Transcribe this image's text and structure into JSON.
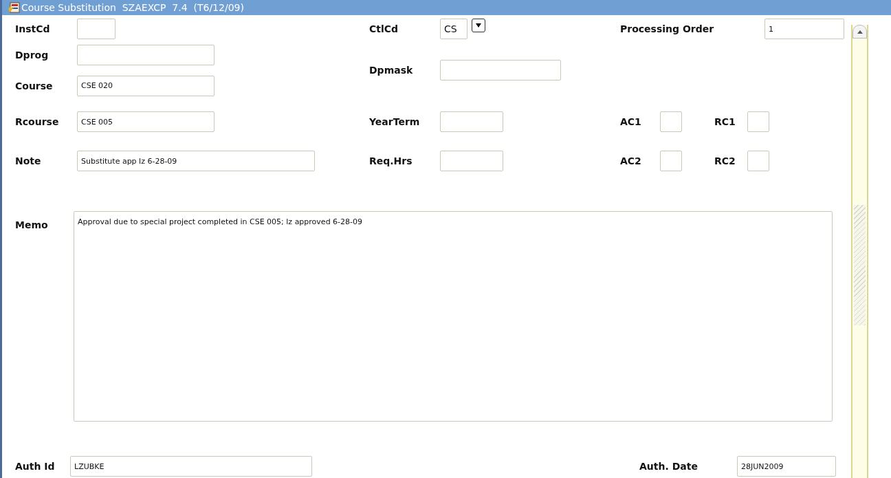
{
  "window": {
    "title": "Course Substitution  SZAEXCP  7.4  (T6/12/09)"
  },
  "fields": {
    "inst_cd": {
      "label": "InstCd"
    },
    "dprog": {
      "label": "Dprog"
    },
    "course": {
      "label": "Course",
      "value": "CSE 020"
    },
    "rcourse": {
      "label": "Rcourse",
      "value": "CSE 005"
    },
    "note": {
      "label": "Note",
      "value": "Substitute app lz 6-28-09"
    },
    "ctl_cd": {
      "label": "CtlCd",
      "value": "CS"
    },
    "dpmask": {
      "label": "Dpmask"
    },
    "year_term": {
      "label": "YearTerm"
    },
    "req_hrs": {
      "label": "Req.Hrs"
    },
    "processing_order": {
      "label": "Processing Order",
      "value": "1"
    },
    "ac1": {
      "label": "AC1"
    },
    "rc1": {
      "label": "RC1"
    },
    "ac2": {
      "label": "AC2"
    },
    "rc2": {
      "label": "RC2"
    },
    "memo": {
      "label": "Memo",
      "value": "Approval due to special project completed in CSE 005; lz approved 6-28-09"
    },
    "auth_id": {
      "label": "Auth Id",
      "value": "LZUBKE"
    },
    "auth_date": {
      "label": "Auth. Date",
      "value": "28JUN2009"
    }
  }
}
